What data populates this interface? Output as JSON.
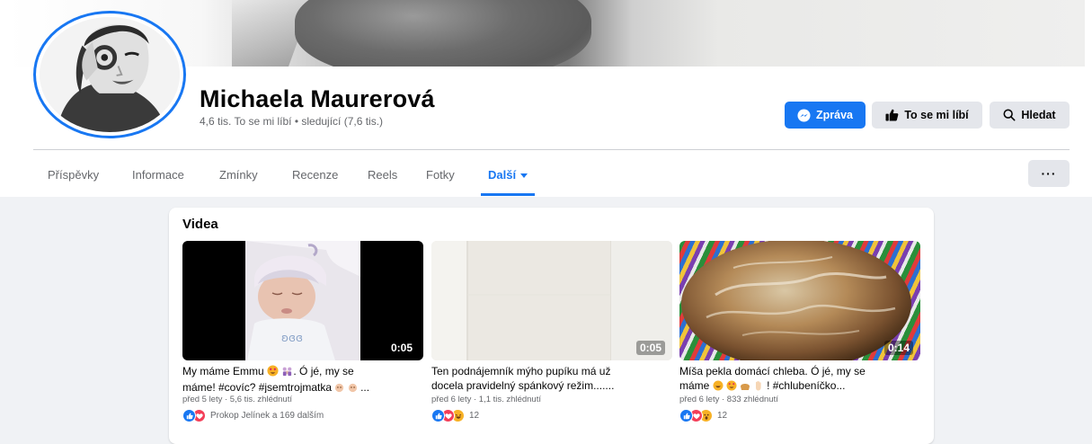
{
  "profile": {
    "name": "Michaela Maurerová",
    "stats": "4,6 tis. To se mi líbí • sledující (7,6 tis.)"
  },
  "actions": {
    "message": "Zpráva",
    "like": "To se mi líbí",
    "search": "Hledat",
    "more": "···"
  },
  "tabs": [
    {
      "label": "Příspěvky"
    },
    {
      "label": "Informace"
    },
    {
      "label": "Zmínky"
    },
    {
      "label": "Recenze"
    },
    {
      "label": "Reels"
    },
    {
      "label": "Fotky"
    },
    {
      "label": "Další"
    }
  ],
  "active_tab": "Další",
  "videos": {
    "heading": "Videa",
    "items": [
      {
        "duration": "0:05",
        "title_line1": "My máme Emmu",
        "title_line1_tail": ". Ó jé, my se",
        "title_line2": "máme! #covíc? #jsemtrojmatka",
        "title_line2_tail": "...",
        "meta": "před 5 lety · 5,6 tis. zhlédnutí",
        "reactions": "Prokop Jelínek a 169 dalším"
      },
      {
        "duration": "0:05",
        "title_line1": "Ten podnájemník mýho pupíku má už",
        "title_line2": "docela pravidelný spánkový režim.......",
        "meta": "před 6 lety · 1,1 tis. zhlédnutí",
        "reactions": "12"
      },
      {
        "duration": "0:14",
        "title_line1": "Míša pekla domácí chleba. Ó jé, my se",
        "title_line2": "máme",
        "title_line2_tail": "! #chlubeníčko...",
        "meta": "před 6 lety · 833 zhlédnutí",
        "reactions": "12"
      }
    ]
  },
  "colors": {
    "brand": "#1877f2",
    "secondary_button": "#e4e6eb",
    "page_bg": "#f0f2f5",
    "like": "#1877f2",
    "love": "#f33e58",
    "haha": "#f7b125"
  },
  "icons": {
    "message": "messenger-icon",
    "like": "thumbs-up-icon",
    "search": "magnifier-icon",
    "dropdown": "caret-down-icon"
  }
}
